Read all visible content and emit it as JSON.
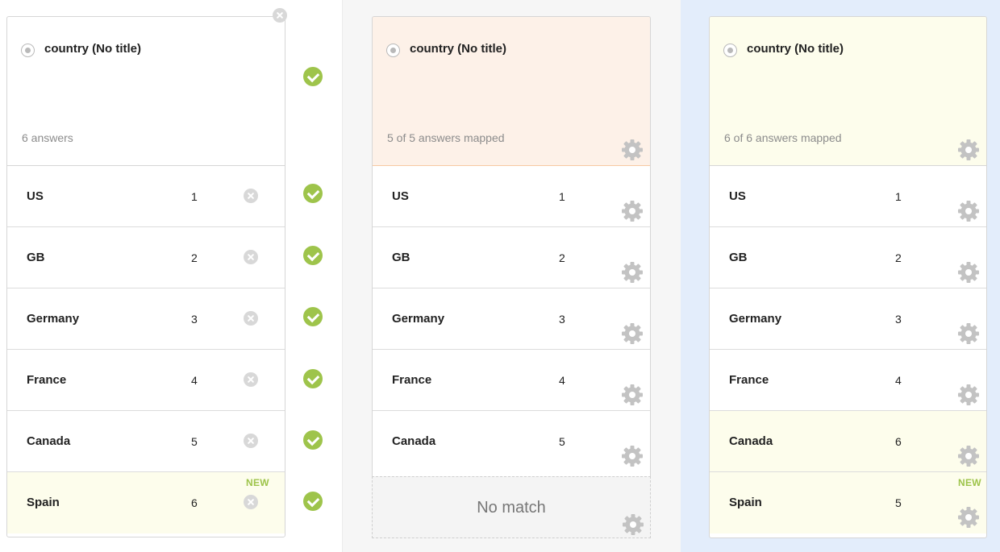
{
  "left_panel": {
    "question_title": "country (No title)",
    "answer_summary": "6 answers",
    "answers": [
      {
        "label": "US",
        "value": "1"
      },
      {
        "label": "GB",
        "value": "2"
      },
      {
        "label": "Germany",
        "value": "3"
      },
      {
        "label": "France",
        "value": "4"
      },
      {
        "label": "Canada",
        "value": "5"
      },
      {
        "label": "Spain",
        "value": "6",
        "badge": "NEW"
      }
    ]
  },
  "middle_panel": {
    "question_title": "country (No title)",
    "mapping_summary": "5 of 5 answers mapped",
    "answers": [
      {
        "label": "US",
        "value": "1"
      },
      {
        "label": "GB",
        "value": "2"
      },
      {
        "label": "Germany",
        "value": "3"
      },
      {
        "label": "France",
        "value": "4"
      },
      {
        "label": "Canada",
        "value": "5"
      }
    ],
    "no_match_label": "No match"
  },
  "right_panel": {
    "question_title": "country (No title)",
    "mapping_summary": "6 of 6 answers mapped",
    "answers": [
      {
        "label": "US",
        "value": "1"
      },
      {
        "label": "GB",
        "value": "2"
      },
      {
        "label": "Germany",
        "value": "3"
      },
      {
        "label": "France",
        "value": "4"
      },
      {
        "label": "Canada",
        "value": "6"
      },
      {
        "label": "Spain",
        "value": "5",
        "badge": "NEW"
      }
    ]
  },
  "icons": {
    "match": "check-circle-icon",
    "remove": "close-circle-icon",
    "settings": "gear-icon",
    "radio": "radio-icon"
  },
  "colors": {
    "check_green": "#9ec44b",
    "new_badge": "#9ec44b",
    "highlight_orange": "#fdf1e8",
    "highlight_yellow": "#fdfdec",
    "right_column_bg": "#e3edfb"
  }
}
